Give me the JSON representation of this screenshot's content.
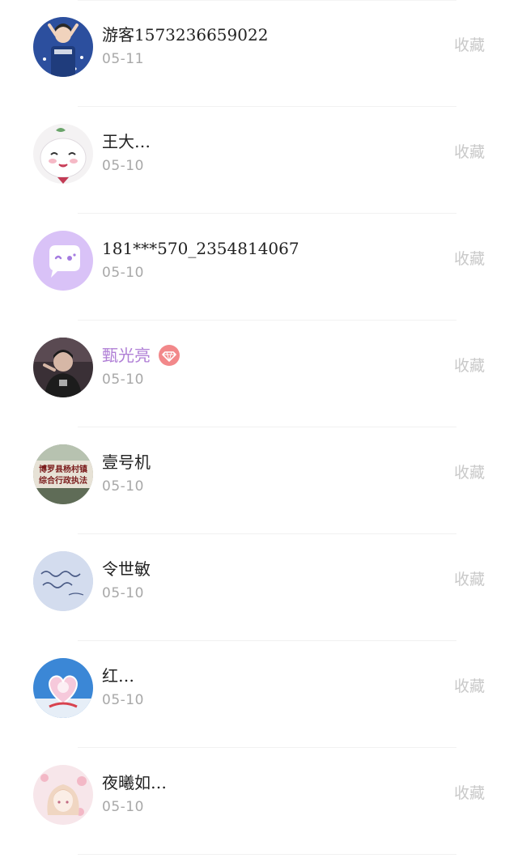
{
  "contacts": [
    {
      "name": "游客1573236659022",
      "date": "05-11",
      "action": "收藏",
      "avatar_icon": "photo-avatar-blue"
    },
    {
      "name": "王大…",
      "date": "05-10",
      "action": "收藏",
      "avatar_icon": "cartoon-avatar-white"
    },
    {
      "name": "181***570_2354814067",
      "date": "05-10",
      "action": "收藏",
      "avatar_icon": "default-chat-avatar"
    },
    {
      "name": "甄光亮",
      "date": "05-10",
      "action": "收藏",
      "avatar_icon": "photo-avatar-dark",
      "vip": true,
      "badge_icon": "diamond-icon"
    },
    {
      "name": "壹号机",
      "date": "05-10",
      "action": "收藏",
      "avatar_icon": "banner-photo-avatar",
      "avatar_text": [
        "博罗县杨村镇",
        "综合行政执法"
      ]
    },
    {
      "name": "令世敏",
      "date": "05-10",
      "action": "收藏",
      "avatar_icon": "handwriting-avatar"
    },
    {
      "name": "红…",
      "date": "05-10",
      "action": "收藏",
      "avatar_icon": "heart-balloon-avatar"
    },
    {
      "name": "夜曦如…",
      "date": "05-10",
      "action": "收藏",
      "avatar_icon": "anime-avatar-pink"
    }
  ],
  "colors": {
    "name": "#222222",
    "vip_name": "#b07fd6",
    "date": "#a8a8a8",
    "action": "#c9c9c9",
    "vip_badge": "#f2888a",
    "default_avatar": "#d4bcf5"
  }
}
